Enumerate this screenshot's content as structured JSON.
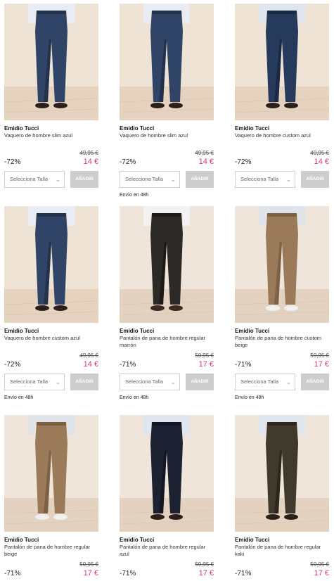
{
  "colors": {
    "accent_price": "#e2317c",
    "add_button_bg": "#cdcdcd"
  },
  "products": [
    {
      "brand": "Emidio Tucci",
      "name": "Vaquero de hombre slim azul",
      "discount": "-72%",
      "old_price": "49,95 €",
      "new_price": "14 €",
      "size_placeholder": "Selecciona Talla",
      "add_label": "AÑADIR",
      "shipping": "",
      "image_icon": "jeans-blue"
    },
    {
      "brand": "Emidio Tucci",
      "name": "Vaquero de hombre slim azul",
      "discount": "-72%",
      "old_price": "49,95 €",
      "new_price": "14 €",
      "size_placeholder": "Selecciona Talla",
      "add_label": "AÑADIR",
      "shipping": "Envío en 48h",
      "image_icon": "jeans-blue"
    },
    {
      "brand": "Emidio Tucci",
      "name": "Vaquero de hombre custom azul",
      "discount": "-72%",
      "old_price": "49,95 €",
      "new_price": "14 €",
      "size_placeholder": "Selecciona Talla",
      "add_label": "AÑADIR",
      "shipping": "",
      "image_icon": "jeans-dark-blue"
    },
    {
      "brand": "Emidio Tucci",
      "name": "Vaquero de hombre custom azul",
      "discount": "-72%",
      "old_price": "49,95 €",
      "new_price": "14 €",
      "size_placeholder": "Selecciona Talla",
      "add_label": "AÑADIR",
      "shipping": "Envío en 48h",
      "image_icon": "jeans-blue"
    },
    {
      "brand": "Emidio Tucci",
      "name": "Pantalón de pana de hombre regular marrón",
      "discount": "-71%",
      "old_price": "59,95 €",
      "new_price": "17 €",
      "size_placeholder": "Selecciona Talla",
      "add_label": "AÑADIR",
      "shipping": "Envío en 48h",
      "image_icon": "corduroy-brown"
    },
    {
      "brand": "Emidio Tucci",
      "name": "Pantalón de pana de hombre custom beige",
      "discount": "-71%",
      "old_price": "59,95 €",
      "new_price": "17 €",
      "size_placeholder": "Selecciona Talla",
      "add_label": "AÑADIR",
      "shipping": "Envío en 48h",
      "image_icon": "corduroy-beige"
    },
    {
      "brand": "Emidio Tucci",
      "name": "Pantalón de pana de hombre regular beige",
      "discount": "-71%",
      "old_price": "59,95 €",
      "new_price": "17 €",
      "size_placeholder": "",
      "add_label": "",
      "shipping": "",
      "image_icon": "corduroy-beige"
    },
    {
      "brand": "Emidio Tucci",
      "name": "Pantalón de pana de hombre regular azul",
      "discount": "-71%",
      "old_price": "59,95 €",
      "new_price": "17 €",
      "size_placeholder": "",
      "add_label": "",
      "shipping": "",
      "image_icon": "corduroy-navy"
    },
    {
      "brand": "Emidio Tucci",
      "name": "Pantalón de pana de hombre regular kaki",
      "discount": "-71%",
      "old_price": "59,95 €",
      "new_price": "17 €",
      "size_placeholder": "",
      "add_label": "",
      "shipping": "",
      "image_icon": "corduroy-khaki"
    }
  ]
}
